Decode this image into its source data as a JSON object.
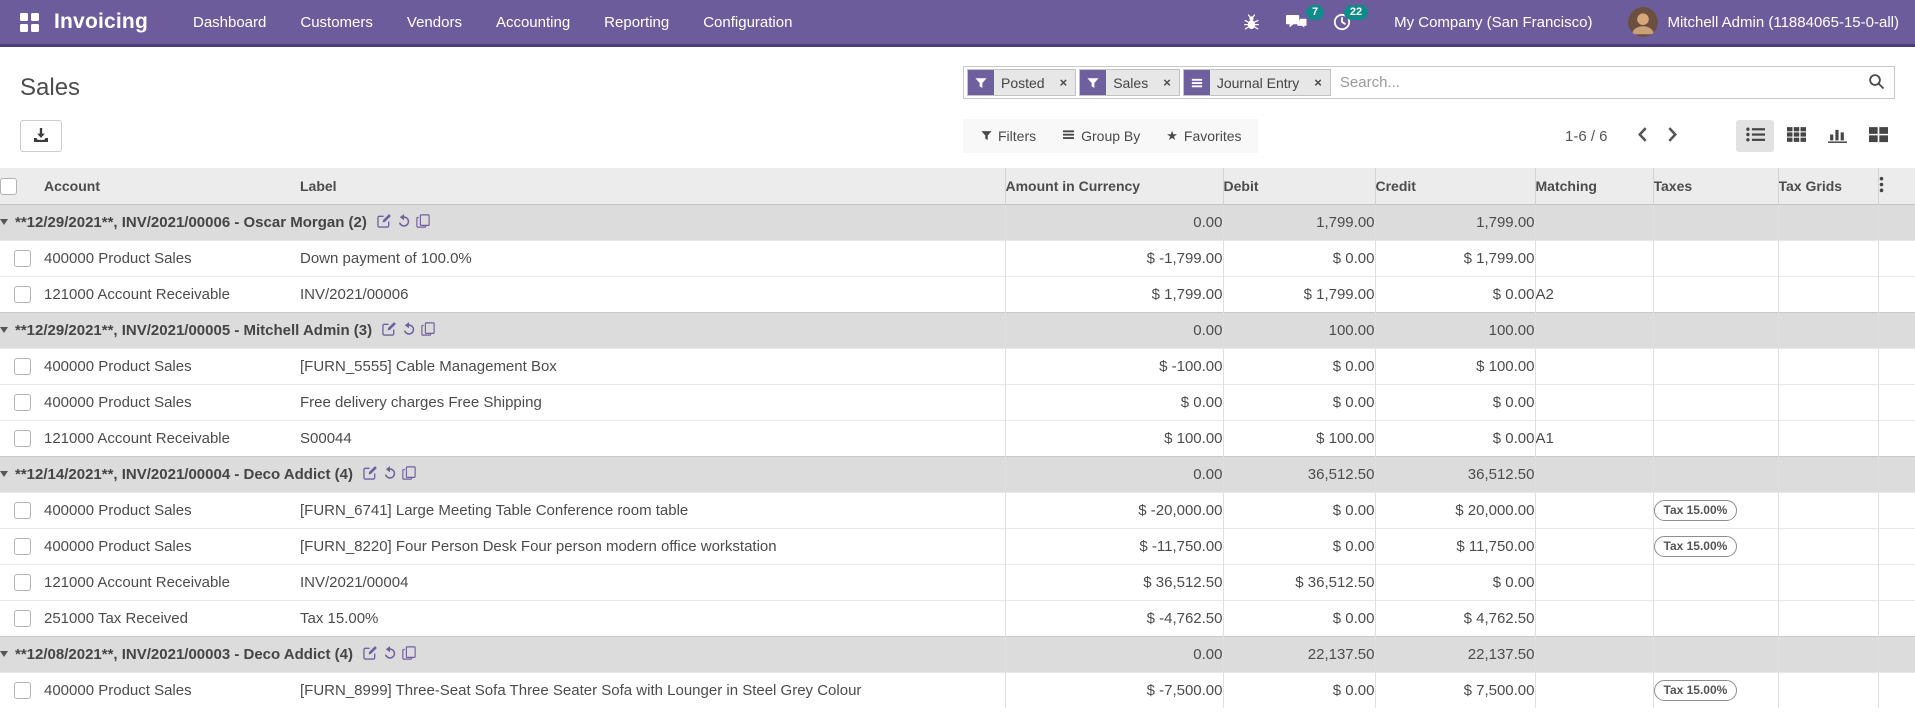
{
  "navbar": {
    "brand": "Invoicing",
    "menus": [
      "Dashboard",
      "Customers",
      "Vendors",
      "Accounting",
      "Reporting",
      "Configuration"
    ],
    "message_badge": "7",
    "activity_badge": "22",
    "company": "My Company (San Francisco)",
    "user": "Mitchell Admin (11884065-15-0-all)"
  },
  "control_panel": {
    "title": "Sales",
    "search_placeholder": "Search...",
    "facets": [
      {
        "label": "Posted"
      },
      {
        "label": "Sales"
      },
      {
        "label": "Journal Entry"
      }
    ],
    "filters_label": "Filters",
    "group_by_label": "Group By",
    "favorites_label": "Favorites",
    "pager": "1-6 / 6"
  },
  "table": {
    "headers": {
      "account": "Account",
      "label": "Label",
      "amount_currency": "Amount in Currency",
      "debit": "Debit",
      "credit": "Credit",
      "matching": "Matching",
      "taxes": "Taxes",
      "tax_grids": "Tax Grids"
    },
    "groups": [
      {
        "title": "**12/29/2021**, INV/2021/00006 - Oscar Morgan (2)",
        "amount_currency": "0.00",
        "debit": "1,799.00",
        "credit": "1,799.00",
        "rows": [
          {
            "account": "400000 Product Sales",
            "label": "Down payment of 100.0%",
            "amount_currency": "$ -1,799.00",
            "debit": "$ 0.00",
            "credit": "$ 1,799.00",
            "matching": "",
            "tax": ""
          },
          {
            "account": "121000 Account Receivable",
            "label": "INV/2021/00006",
            "amount_currency": "$ 1,799.00",
            "debit": "$ 1,799.00",
            "credit": "$ 0.00",
            "matching": "A2",
            "tax": ""
          }
        ]
      },
      {
        "title": "**12/29/2021**, INV/2021/00005 - Mitchell Admin (3)",
        "amount_currency": "0.00",
        "debit": "100.00",
        "credit": "100.00",
        "rows": [
          {
            "account": "400000 Product Sales",
            "label": "[FURN_5555] Cable Management Box",
            "amount_currency": "$ -100.00",
            "debit": "$ 0.00",
            "credit": "$ 100.00",
            "matching": "",
            "tax": ""
          },
          {
            "account": "400000 Product Sales",
            "label": "Free delivery charges Free Shipping",
            "amount_currency": "$ 0.00",
            "debit": "$ 0.00",
            "credit": "$ 0.00",
            "matching": "",
            "tax": ""
          },
          {
            "account": "121000 Account Receivable",
            "label": "S00044",
            "amount_currency": "$ 100.00",
            "debit": "$ 100.00",
            "credit": "$ 0.00",
            "matching": "A1",
            "tax": ""
          }
        ]
      },
      {
        "title": "**12/14/2021**, INV/2021/00004 - Deco Addict (4)",
        "amount_currency": "0.00",
        "debit": "36,512.50",
        "credit": "36,512.50",
        "rows": [
          {
            "account": "400000 Product Sales",
            "label": "[FURN_6741] Large Meeting Table Conference room table",
            "amount_currency": "$ -20,000.00",
            "debit": "$ 0.00",
            "credit": "$ 20,000.00",
            "matching": "",
            "tax": "Tax 15.00%"
          },
          {
            "account": "400000 Product Sales",
            "label": "[FURN_8220] Four Person Desk Four person modern office workstation",
            "amount_currency": "$ -11,750.00",
            "debit": "$ 0.00",
            "credit": "$ 11,750.00",
            "matching": "",
            "tax": "Tax 15.00%"
          },
          {
            "account": "121000 Account Receivable",
            "label": "INV/2021/00004",
            "amount_currency": "$ 36,512.50",
            "debit": "$ 36,512.50",
            "credit": "$ 0.00",
            "matching": "",
            "tax": ""
          },
          {
            "account": "251000 Tax Received",
            "label": "Tax 15.00%",
            "amount_currency": "$ -4,762.50",
            "debit": "$ 0.00",
            "credit": "$ 4,762.50",
            "matching": "",
            "tax": ""
          }
        ]
      },
      {
        "title": "**12/08/2021**, INV/2021/00003 - Deco Addict (4)",
        "amount_currency": "0.00",
        "debit": "22,137.50",
        "credit": "22,137.50",
        "rows": [
          {
            "account": "400000 Product Sales",
            "label": "[FURN_8999] Three-Seat Sofa Three Seater Sofa with Lounger in Steel Grey Colour",
            "amount_currency": "$ -7,500.00",
            "debit": "$ 0.00",
            "credit": "$ 7,500.00",
            "matching": "",
            "tax": "Tax 15.00%"
          }
        ]
      }
    ]
  },
  "colors": {
    "navbar_bg": "#6d5c9b",
    "navbar_border": "#4e3d7c",
    "badge_bg": "#0e8c8c",
    "accent": "#6e5f9e"
  }
}
